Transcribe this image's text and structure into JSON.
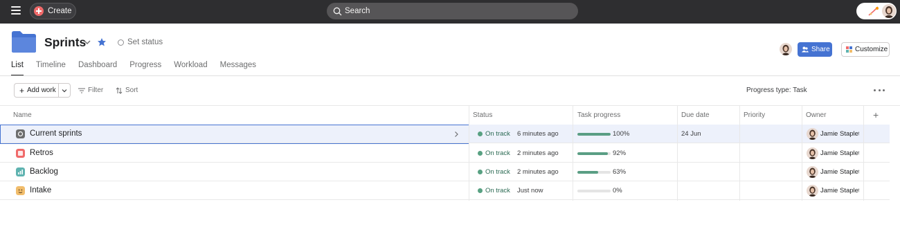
{
  "topbar": {
    "menu_icon": "hamburger-icon",
    "create_label": "Create",
    "search_placeholder": "Search"
  },
  "project": {
    "title": "Sprints",
    "set_status_label": "Set status",
    "icon": "folder-icon",
    "icon_color": "#4573d2"
  },
  "header_actions": {
    "share_label": "Share",
    "customize_label": "Customize",
    "share_color": "#4573d2"
  },
  "tabs": [
    {
      "label": "List",
      "active": true
    },
    {
      "label": "Timeline",
      "active": false
    },
    {
      "label": "Dashboard",
      "active": false
    },
    {
      "label": "Progress",
      "active": false
    },
    {
      "label": "Workload",
      "active": false
    },
    {
      "label": "Messages",
      "active": false
    }
  ],
  "toolbar": {
    "add_work_label": "Add work",
    "filter_label": "Filter",
    "sort_label": "Sort",
    "progress_type": "Progress type: Task"
  },
  "columns": {
    "name": "Name",
    "status": "Status",
    "task_progress": "Task progress",
    "due_date": "Due date",
    "priority": "Priority",
    "owner": "Owner"
  },
  "rows": [
    {
      "name": "Current sprints",
      "icon": "sprint-icon",
      "icon_color": "#6d6e6f",
      "status": "On track",
      "updated": "6 minutes ago",
      "progress": 100,
      "progress_label": "100%",
      "due": "24 Jun",
      "priority": "",
      "owner": "Jamie Stapleton",
      "selected": true
    },
    {
      "name": "Retros",
      "icon": "retro-icon",
      "icon_color": "#f06a6a",
      "status": "On track",
      "updated": "2 minutes ago",
      "progress": 92,
      "progress_label": "92%",
      "due": "",
      "priority": "",
      "owner": "Jamie Stapleton",
      "selected": false
    },
    {
      "name": "Backlog",
      "icon": "chart-icon",
      "icon_color": "#5fb3b0",
      "status": "On track",
      "updated": "2 minutes ago",
      "progress": 63,
      "progress_label": "63%",
      "due": "",
      "priority": "",
      "owner": "Jamie Stapleton",
      "selected": false
    },
    {
      "name": "Intake",
      "icon": "face-icon",
      "icon_color": "#f1bd6c",
      "status": "On track",
      "updated": "Just now",
      "progress": 0,
      "progress_label": "0%",
      "due": "",
      "priority": "",
      "owner": "Jamie Stapleton",
      "selected": false
    }
  ],
  "colors": {
    "topbar_bg": "#2e2e30",
    "status_green": "#58a182",
    "progress_green": "#5a9e84"
  }
}
